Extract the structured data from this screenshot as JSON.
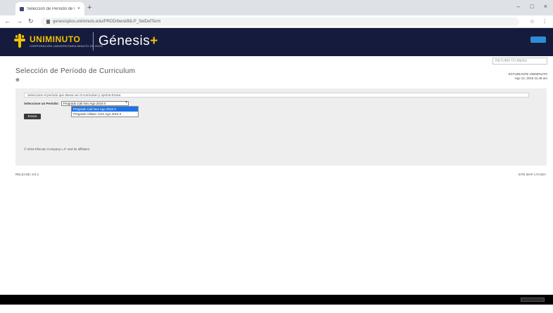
{
  "browser": {
    "tab_title": "Selección de Período de Curric...",
    "tab_close": "×",
    "new_tab": "+",
    "window_controls": [
      "–",
      "□",
      "×"
    ],
    "nav": [
      "←",
      "→",
      "↻"
    ],
    "url": "genesisplus.uniminuto.edu/PROD/bwskflib.P_SelDefTerm",
    "addr_icons": [
      "☆",
      "⋮"
    ]
  },
  "banner": {
    "brand_name": "UNIMINUTO",
    "brand_sub": "CORPORACIÓN UNIVERSITARIA MINUTO DE DIOS",
    "product": "Génesis",
    "product_plus": "+"
  },
  "header": {
    "search_placeholder": "RETURN TO MENU",
    "page_title": "Selección de Período de Curriculum",
    "help_icon": "⊕",
    "user_name": "ESTUDIANTE UNIMINUTO",
    "user_date": "Ago 12, 2016 11:45 am"
  },
  "form": {
    "info": "Seleccione el período que desea ver el curriculum y oprima Enviar.",
    "label": "Seleccione un Período:",
    "selected_value": "Pregrado Cali Nov Ago 2016 II",
    "options": [
      "Pregrado Cali Nov Ago 2016 II",
      "Pregrado Villavic Cien Ago 2016 II"
    ],
    "submit": "Enviar"
  },
  "release": "© 2016 Ellucian Company L.P. and its affiliates.",
  "footer": {
    "left": "RELEASE: 8.9.1",
    "right": "SITE MAP | AYUDA"
  },
  "colors": {
    "banner": "#151b3d",
    "brand_yellow": "#f2c200",
    "selection_blue": "#1e73e8"
  }
}
